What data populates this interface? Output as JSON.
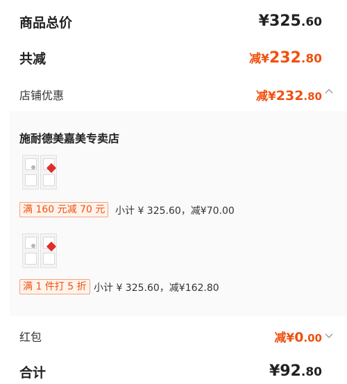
{
  "summary": {
    "total_label": "商品总价",
    "total_currency": "¥",
    "total_int": "325",
    "total_dec": ".60",
    "reduce_label": "共减",
    "reduce_prefix": "减",
    "reduce_currency": "¥",
    "reduce_int": "232",
    "reduce_dec": ".80"
  },
  "store_discount": {
    "label": "店铺优惠",
    "prefix": "减",
    "currency": "¥",
    "int": "232",
    "dec": ".80",
    "chevron": "chevron-up-icon"
  },
  "store": {
    "name": "施耐德美嘉美专卖店",
    "promotions": [
      {
        "tag": "满 160 元减 70 元",
        "detail": "小计 ¥ 325.60，减¥70.00"
      },
      {
        "tag": "满 1 件打 5 折",
        "detail": "小计 ¥ 325.60，减¥162.80"
      }
    ]
  },
  "red_packet": {
    "label": "红包",
    "prefix": "减",
    "currency": "¥",
    "int": "0",
    "dec": ".00",
    "chevron": "chevron-down-icon"
  },
  "grand_total": {
    "label": "合计",
    "currency": "¥",
    "int": "92",
    "dec": ".80"
  },
  "colors": {
    "accent": "#f0500f",
    "panel_bg": "#fafafa"
  }
}
